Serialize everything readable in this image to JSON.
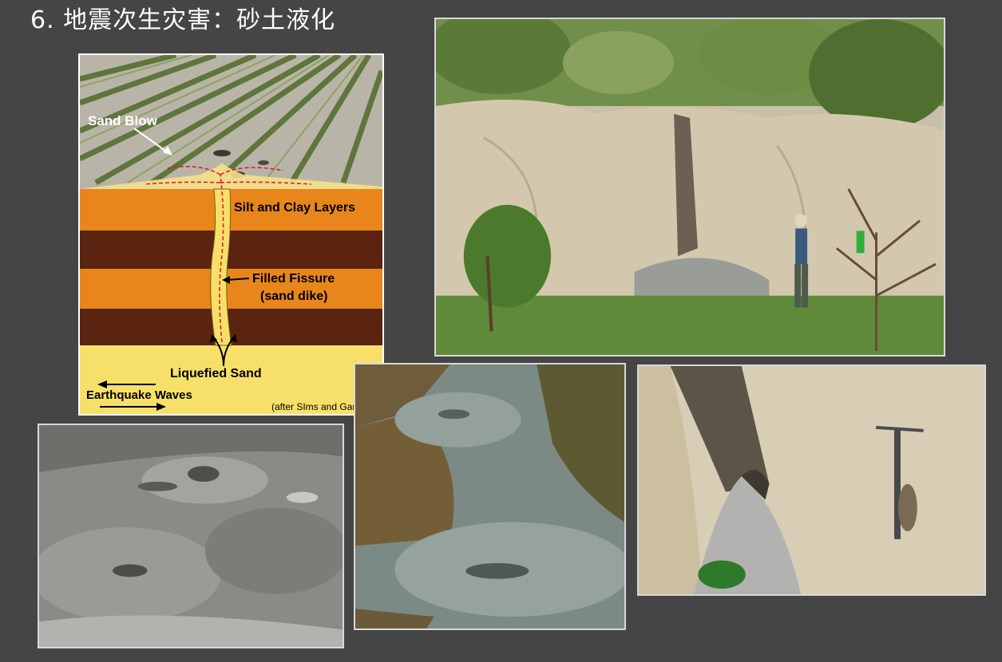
{
  "slide": {
    "title": "6. 地震次生灾害：砂土液化"
  },
  "diagram": {
    "sand_blow": "Sand Blow",
    "silt_clay": "Silt and Clay Layers",
    "filled_fissure": "Filled Fissure",
    "sand_dike": "(sand dike)",
    "liquefied_sand": "Liquefied Sand",
    "earthquake_waves": "Earthquake Waves",
    "credit": "(after SIms and Garvin)"
  },
  "colors": {
    "background": "#454545",
    "orange_layer": "#e8861c",
    "brown_layer": "#5a2410",
    "sand": "#f7e06a",
    "flow_arrows": "#e02020"
  }
}
